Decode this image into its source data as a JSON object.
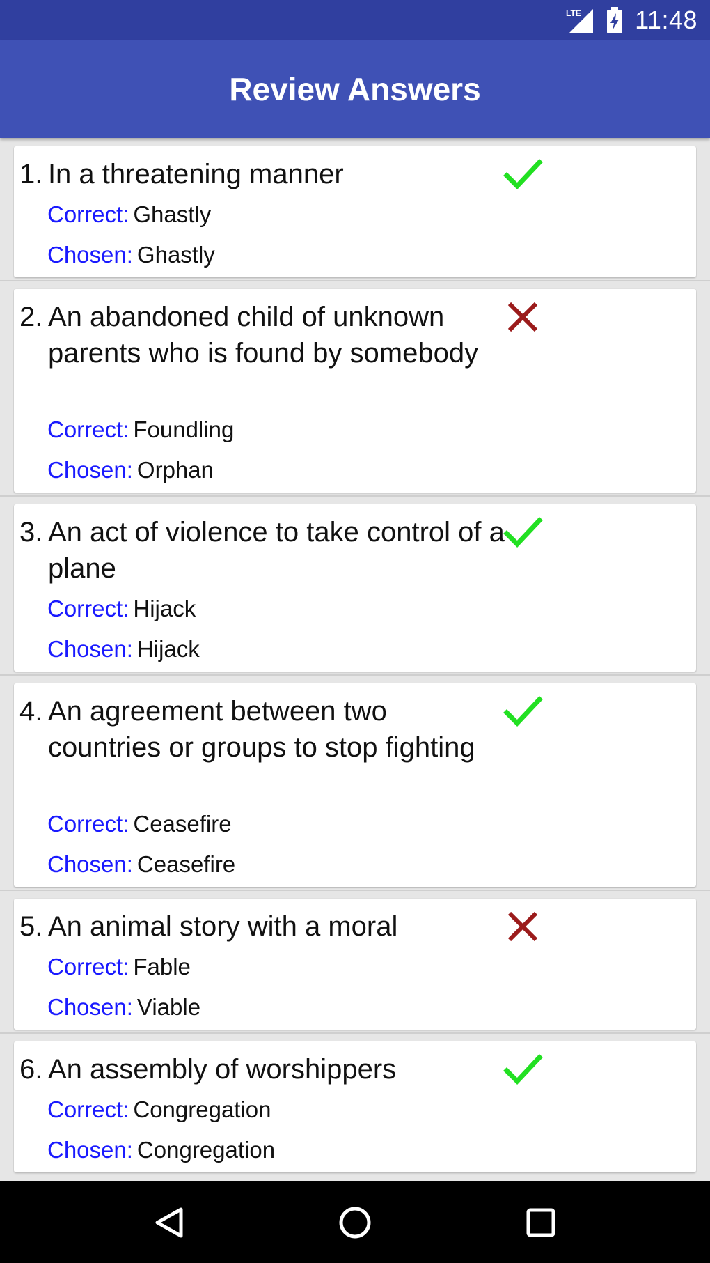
{
  "status_bar": {
    "network_label": "LTE",
    "time": "11:48"
  },
  "header": {
    "title": "Review Answers"
  },
  "labels": {
    "correct": "Correct:",
    "chosen": "Chosen:"
  },
  "colors": {
    "accent": "#3f51b5",
    "status_bar": "#303f9f",
    "label_blue": "#1a1aff",
    "check_green": "#22e022",
    "cross_red": "#9b1b1b"
  },
  "questions": [
    {
      "number": "1.",
      "text": "In a threatening manner",
      "correct": "Ghastly",
      "chosen": "Ghastly",
      "result": "correct",
      "icon": "check-icon"
    },
    {
      "number": "2.",
      "text": "An abandoned child of unknown parents who is found by somebody",
      "correct": "Foundling",
      "chosen": "Orphan",
      "result": "wrong",
      "icon": "cross-icon"
    },
    {
      "number": "3.",
      "text": "An act of violence to take control of a plane",
      "correct": "Hijack",
      "chosen": "Hijack",
      "result": "correct",
      "icon": "check-icon"
    },
    {
      "number": "4.",
      "text": "An agreement between two countries or groups to stop fighting",
      "correct": "Ceasefire",
      "chosen": "Ceasefire",
      "result": "correct",
      "icon": "check-icon"
    },
    {
      "number": "5.",
      "text": "An animal story with a moral",
      "correct": "Fable",
      "chosen": "Viable",
      "result": "wrong",
      "icon": "cross-icon"
    },
    {
      "number": "6.",
      "text": "An assembly of worshippers",
      "correct": "Congregation",
      "chosen": "Congregation",
      "result": "correct",
      "icon": "check-icon"
    }
  ],
  "nav_bar": {
    "back_icon": "back-icon",
    "home_icon": "home-icon",
    "recents_icon": "recents-icon"
  }
}
